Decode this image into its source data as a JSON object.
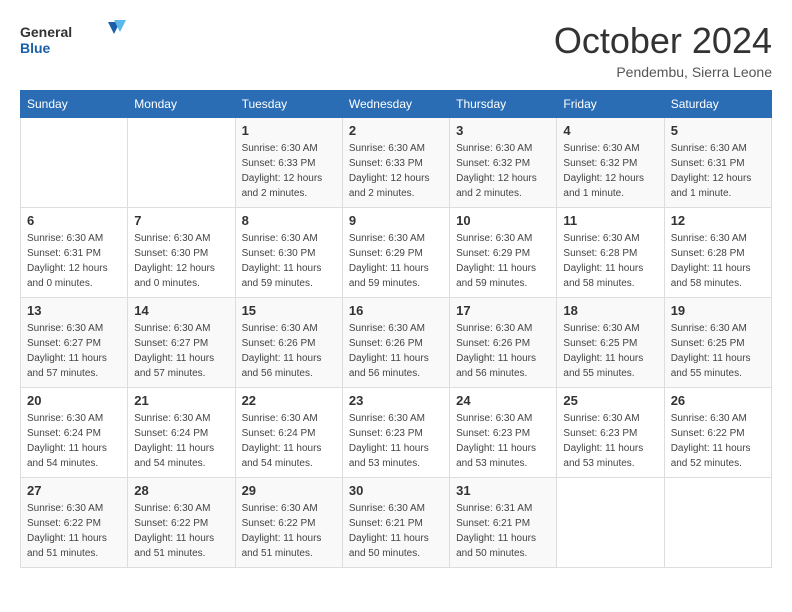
{
  "header": {
    "logo_general": "General",
    "logo_blue": "Blue",
    "month_title": "October 2024",
    "location": "Pendembu, Sierra Leone"
  },
  "days_of_week": [
    "Sunday",
    "Monday",
    "Tuesday",
    "Wednesday",
    "Thursday",
    "Friday",
    "Saturday"
  ],
  "weeks": [
    [
      {
        "day": "",
        "details": ""
      },
      {
        "day": "",
        "details": ""
      },
      {
        "day": "1",
        "details": "Sunrise: 6:30 AM\nSunset: 6:33 PM\nDaylight: 12 hours\nand 2 minutes."
      },
      {
        "day": "2",
        "details": "Sunrise: 6:30 AM\nSunset: 6:33 PM\nDaylight: 12 hours\nand 2 minutes."
      },
      {
        "day": "3",
        "details": "Sunrise: 6:30 AM\nSunset: 6:32 PM\nDaylight: 12 hours\nand 2 minutes."
      },
      {
        "day": "4",
        "details": "Sunrise: 6:30 AM\nSunset: 6:32 PM\nDaylight: 12 hours\nand 1 minute."
      },
      {
        "day": "5",
        "details": "Sunrise: 6:30 AM\nSunset: 6:31 PM\nDaylight: 12 hours\nand 1 minute."
      }
    ],
    [
      {
        "day": "6",
        "details": "Sunrise: 6:30 AM\nSunset: 6:31 PM\nDaylight: 12 hours\nand 0 minutes."
      },
      {
        "day": "7",
        "details": "Sunrise: 6:30 AM\nSunset: 6:30 PM\nDaylight: 12 hours\nand 0 minutes."
      },
      {
        "day": "8",
        "details": "Sunrise: 6:30 AM\nSunset: 6:30 PM\nDaylight: 11 hours\nand 59 minutes."
      },
      {
        "day": "9",
        "details": "Sunrise: 6:30 AM\nSunset: 6:29 PM\nDaylight: 11 hours\nand 59 minutes."
      },
      {
        "day": "10",
        "details": "Sunrise: 6:30 AM\nSunset: 6:29 PM\nDaylight: 11 hours\nand 59 minutes."
      },
      {
        "day": "11",
        "details": "Sunrise: 6:30 AM\nSunset: 6:28 PM\nDaylight: 11 hours\nand 58 minutes."
      },
      {
        "day": "12",
        "details": "Sunrise: 6:30 AM\nSunset: 6:28 PM\nDaylight: 11 hours\nand 58 minutes."
      }
    ],
    [
      {
        "day": "13",
        "details": "Sunrise: 6:30 AM\nSunset: 6:27 PM\nDaylight: 11 hours\nand 57 minutes."
      },
      {
        "day": "14",
        "details": "Sunrise: 6:30 AM\nSunset: 6:27 PM\nDaylight: 11 hours\nand 57 minutes."
      },
      {
        "day": "15",
        "details": "Sunrise: 6:30 AM\nSunset: 6:26 PM\nDaylight: 11 hours\nand 56 minutes."
      },
      {
        "day": "16",
        "details": "Sunrise: 6:30 AM\nSunset: 6:26 PM\nDaylight: 11 hours\nand 56 minutes."
      },
      {
        "day": "17",
        "details": "Sunrise: 6:30 AM\nSunset: 6:26 PM\nDaylight: 11 hours\nand 56 minutes."
      },
      {
        "day": "18",
        "details": "Sunrise: 6:30 AM\nSunset: 6:25 PM\nDaylight: 11 hours\nand 55 minutes."
      },
      {
        "day": "19",
        "details": "Sunrise: 6:30 AM\nSunset: 6:25 PM\nDaylight: 11 hours\nand 55 minutes."
      }
    ],
    [
      {
        "day": "20",
        "details": "Sunrise: 6:30 AM\nSunset: 6:24 PM\nDaylight: 11 hours\nand 54 minutes."
      },
      {
        "day": "21",
        "details": "Sunrise: 6:30 AM\nSunset: 6:24 PM\nDaylight: 11 hours\nand 54 minutes."
      },
      {
        "day": "22",
        "details": "Sunrise: 6:30 AM\nSunset: 6:24 PM\nDaylight: 11 hours\nand 54 minutes."
      },
      {
        "day": "23",
        "details": "Sunrise: 6:30 AM\nSunset: 6:23 PM\nDaylight: 11 hours\nand 53 minutes."
      },
      {
        "day": "24",
        "details": "Sunrise: 6:30 AM\nSunset: 6:23 PM\nDaylight: 11 hours\nand 53 minutes."
      },
      {
        "day": "25",
        "details": "Sunrise: 6:30 AM\nSunset: 6:23 PM\nDaylight: 11 hours\nand 53 minutes."
      },
      {
        "day": "26",
        "details": "Sunrise: 6:30 AM\nSunset: 6:22 PM\nDaylight: 11 hours\nand 52 minutes."
      }
    ],
    [
      {
        "day": "27",
        "details": "Sunrise: 6:30 AM\nSunset: 6:22 PM\nDaylight: 11 hours\nand 51 minutes."
      },
      {
        "day": "28",
        "details": "Sunrise: 6:30 AM\nSunset: 6:22 PM\nDaylight: 11 hours\nand 51 minutes."
      },
      {
        "day": "29",
        "details": "Sunrise: 6:30 AM\nSunset: 6:22 PM\nDaylight: 11 hours\nand 51 minutes."
      },
      {
        "day": "30",
        "details": "Sunrise: 6:30 AM\nSunset: 6:21 PM\nDaylight: 11 hours\nand 50 minutes."
      },
      {
        "day": "31",
        "details": "Sunrise: 6:31 AM\nSunset: 6:21 PM\nDaylight: 11 hours\nand 50 minutes."
      },
      {
        "day": "",
        "details": ""
      },
      {
        "day": "",
        "details": ""
      }
    ]
  ]
}
